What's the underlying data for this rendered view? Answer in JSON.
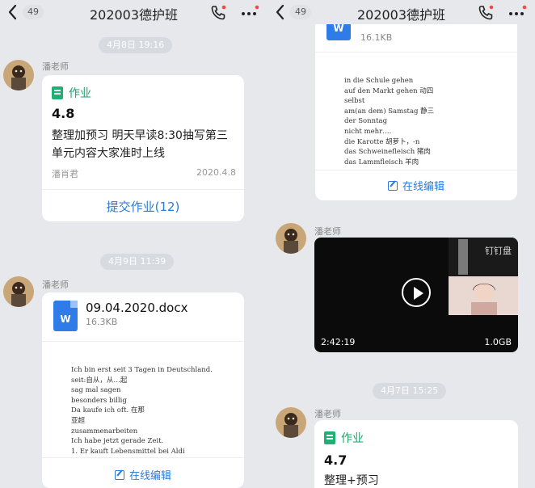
{
  "header": {
    "back_count": "49",
    "title": "202003德护班"
  },
  "left": {
    "time1": "4月8日 19:16",
    "msg1": {
      "sender": "潘老师",
      "tag": "作业",
      "title": "4.8",
      "desc": "整理加预习 明天早读8:30抽写第三单元内容大家准时上线",
      "author": "潘肖君",
      "date": "2020.4.8",
      "submit_label": "提交作业(12)"
    },
    "time2": "4月9日 11:39",
    "msg2": {
      "sender": "潘老师",
      "file_name": "09.04.2020.docx",
      "file_size": "16.3KB",
      "preview_lines": [
        "Ich bin erst seit 3 Tagen in Deutschland.",
        "seit:自从，从…起",
        "sag mal      sagen",
        "besonders billig",
        "Da kaufe ich oft.        在那",
        "  亚超",
        "zusammenarbeiten",
        "Ich habe jetzt gerade Zeit.",
        "1.  Er kauft Lebensmittel bei Aldi"
      ],
      "edit_label": "在线编辑"
    }
  },
  "right": {
    "file_card": {
      "file_size": "16.1KB",
      "preview_lines": [
        "in die Schule gehen",
        "auf den Markt gehen 动四",
        "selbst",
        "am(an dem) Samstag  静三",
        "der Sonntag",
        "nicht mehr….",
        "die Karotte  胡萝卜，-n",
        "das Schweinefleisch 猪肉",
        "das Lammfleisch  羊肉"
      ],
      "edit_label": "在线编辑"
    },
    "msg3": {
      "sender": "潘老师",
      "watermark": "钉钉盘",
      "duration": "2:42:19",
      "size": "1.0GB"
    },
    "time3": "4月7日 15:25",
    "msg4": {
      "sender": "潘老师",
      "tag": "作业",
      "title": "4.7",
      "desc": "整理+预习"
    }
  }
}
